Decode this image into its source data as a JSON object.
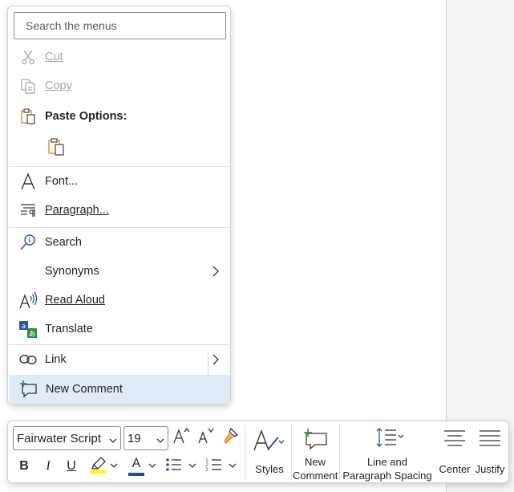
{
  "colors": {
    "accent_blue": "#2b579a",
    "highlight_yellow": "#ffff00",
    "font_color_bar": "#1f4e9a",
    "menu_highlight": "#e1ebf8",
    "paste_orange": "#e47b22"
  },
  "context_menu": {
    "search_placeholder": "Search the menus",
    "items": [
      {
        "label": "Cut",
        "icon": "scissors-icon",
        "enabled": false
      },
      {
        "label": "Copy",
        "icon": "copy-icon",
        "enabled": false
      },
      {
        "label": "Paste Options:",
        "icon": "clipboard-icon"
      },
      {
        "label": "Font...",
        "icon": "font-letter-icon"
      },
      {
        "label": "Paragraph...",
        "icon": "paragraph-icon"
      },
      {
        "label": "Search",
        "icon": "search-globe-icon"
      },
      {
        "label": "Synonyms",
        "icon": "none",
        "submenu": true
      },
      {
        "label": "Read Aloud",
        "icon": "read-aloud-icon"
      },
      {
        "label": "Translate",
        "icon": "translate-icon"
      },
      {
        "label": "Link",
        "icon": "link-icon",
        "submenu": true
      },
      {
        "label": "New Comment",
        "icon": "new-comment-icon",
        "highlighted": true
      }
    ]
  },
  "mini_toolbar": {
    "font_name": "Fairwater Script",
    "font_size": "19",
    "styles_label": "Styles",
    "new_comment_label_1": "New",
    "new_comment_label_2": "Comment",
    "line_spacing_label_1": "Line and",
    "line_spacing_label_2": "Paragraph Spacing",
    "center_label": "Center",
    "justify_label": "Justify",
    "bold_glyph": "B",
    "italic_glyph": "I",
    "underline_glyph": "U",
    "font_color_glyph": "A"
  }
}
